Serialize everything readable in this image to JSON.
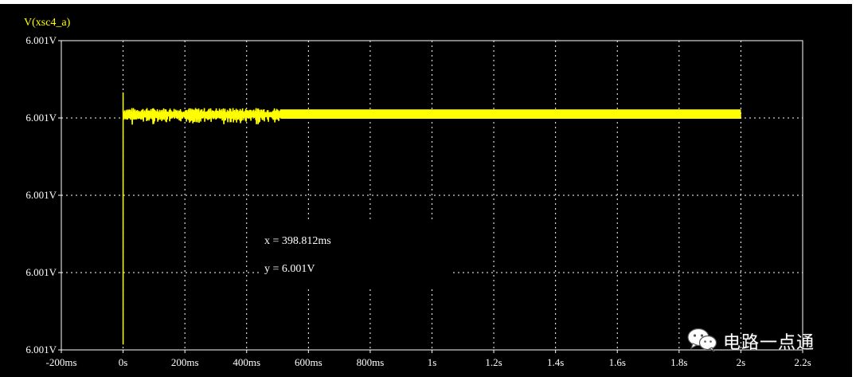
{
  "chart_data": {
    "type": "line",
    "title": "V(xsc4_a)",
    "xlabel": "",
    "ylabel": "",
    "x_ticks": [
      {
        "value": -0.2,
        "label": "-200ms"
      },
      {
        "value": 0,
        "label": "0s"
      },
      {
        "value": 0.2,
        "label": "200ms"
      },
      {
        "value": 0.4,
        "label": "400ms"
      },
      {
        "value": 0.6,
        "label": "600ms"
      },
      {
        "value": 0.8,
        "label": "800ms"
      },
      {
        "value": 1.0,
        "label": "1s"
      },
      {
        "value": 1.2,
        "label": "1.2s"
      },
      {
        "value": 1.4,
        "label": "1.4s"
      },
      {
        "value": 1.6,
        "label": "1.6s"
      },
      {
        "value": 1.8,
        "label": "1.8s"
      },
      {
        "value": 2.0,
        "label": "2s"
      },
      {
        "value": 2.2,
        "label": "2.2s"
      }
    ],
    "y_ticks": [
      {
        "value": 4,
        "label": "6.001V"
      },
      {
        "value": 3,
        "label": "6.001V"
      },
      {
        "value": 2,
        "label": "6.001V"
      },
      {
        "value": 1,
        "label": "6.001V"
      },
      {
        "value": 0,
        "label": "6.001V"
      }
    ],
    "xlim": [
      -0.2,
      2.2
    ],
    "ylim": [
      0,
      4
    ],
    "grid": true,
    "series": [
      {
        "name": "V(xsc4_a)",
        "color": "#ffff00",
        "start_spike": {
          "x": 0,
          "y_top": 3.33,
          "y_bottom": 0.07
        },
        "x_start": 0,
        "x_end": 2.0,
        "level_early": 3.04,
        "level_late": 3.05,
        "settle_x": 0.51,
        "ripple_early": 0.05,
        "ripple_late": 0.06
      }
    ]
  },
  "cursor_readout": {
    "x_text": "x = 398.812ms",
    "y_text": "y = 6.001V"
  },
  "watermark": {
    "icon": "wechat-icon",
    "text": "电路一点通"
  },
  "colors": {
    "background": "#000000",
    "grid": "#ffffff",
    "trace": "#ffff00",
    "frame": "#ffffff",
    "title": "#ffff00"
  }
}
